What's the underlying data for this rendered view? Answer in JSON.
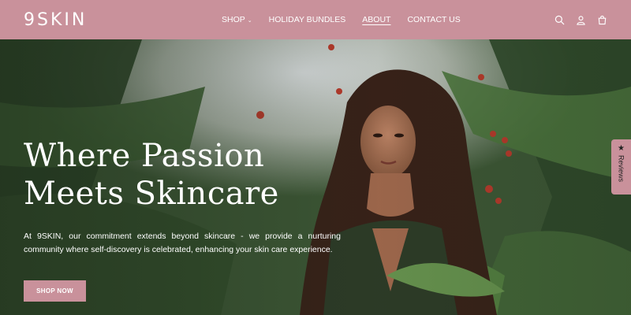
{
  "header": {
    "logo": "9SKIN",
    "nav": [
      {
        "label": "SHOP",
        "has_dropdown": true
      },
      {
        "label": "HOLIDAY BUNDLES"
      },
      {
        "label": "ABOUT",
        "active": true
      },
      {
        "label": "CONTACT US"
      }
    ],
    "icons": [
      "search-icon",
      "account-icon",
      "cart-icon"
    ]
  },
  "hero": {
    "title_line1": "Where Passion",
    "title_line2": "Meets Skincare",
    "text": "At 9SKIN, our commitment extends beyond skincare - we provide a nurturing community where self-discovery is celebrated, enhancing your skin care experience.",
    "cta_label": "SHOP NOW"
  },
  "reviews_tab": {
    "label": "Reviews",
    "icon": "star-icon"
  },
  "colors": {
    "brand_pink": "#c9919b",
    "foliage_dark": "#2f4a2a",
    "text_light": "#ffffff"
  }
}
